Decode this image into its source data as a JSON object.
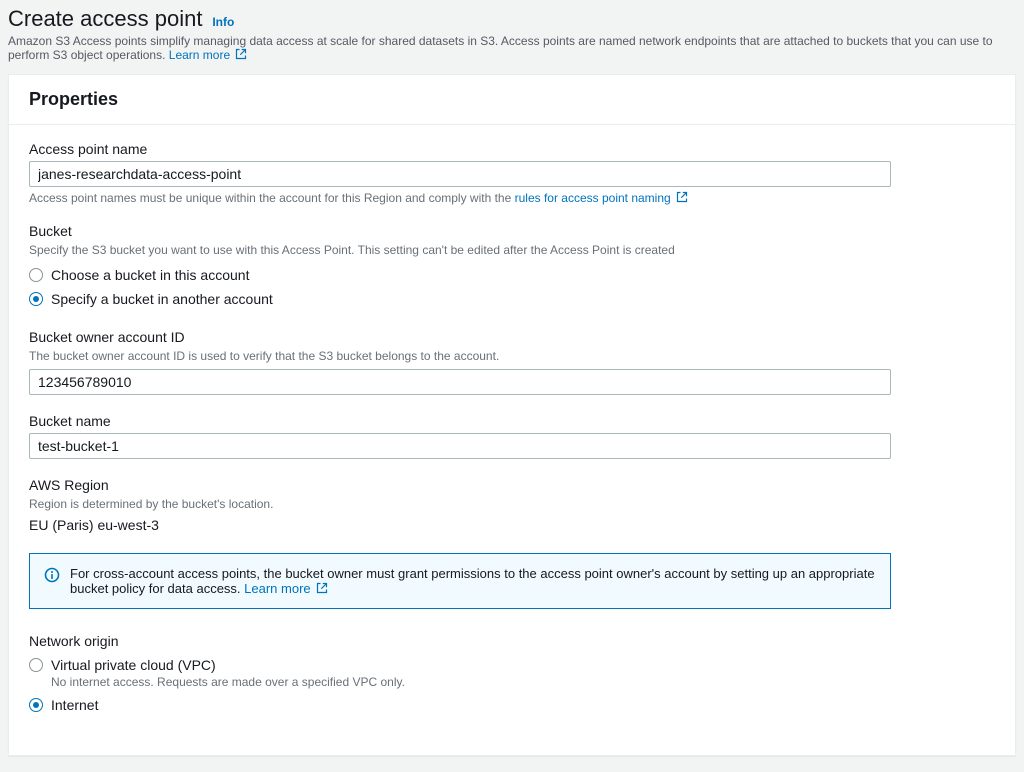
{
  "header": {
    "title": "Create access point",
    "info_label": "Info",
    "description": "Amazon S3 Access points simplify managing data access at scale for shared datasets in S3. Access points are named network endpoints that are attached to buckets that you can use to perform S3 object operations.",
    "learn_more": "Learn more"
  },
  "panel": {
    "title": "Properties"
  },
  "fields": {
    "ap_name": {
      "label": "Access point name",
      "value": "janes-researchdata-access-point",
      "helper_prefix": "Access point names must be unique within the account for this Region and comply with the ",
      "helper_link": "rules for access point naming"
    },
    "bucket": {
      "label": "Bucket",
      "desc": "Specify the S3 bucket you want to use with this Access Point. This setting can't be edited after the Access Point is created",
      "opt_choose": "Choose a bucket in this account",
      "opt_specify": "Specify a bucket in another account"
    },
    "owner_id": {
      "label": "Bucket owner account ID",
      "desc": "The bucket owner account ID is used to verify that the S3 bucket belongs to the account.",
      "value": "123456789010"
    },
    "bucket_name": {
      "label": "Bucket name",
      "value": "test-bucket-1"
    },
    "region": {
      "label": "AWS Region",
      "desc": "Region is determined by the bucket's location.",
      "value": "EU (Paris) eu-west-3"
    },
    "alert": {
      "text": "For cross-account access points, the bucket owner must grant permissions to the access point owner's account by setting up an appropriate bucket policy for data access.",
      "learn_more": "Learn more"
    },
    "network": {
      "label": "Network origin",
      "opt_vpc": "Virtual private cloud (VPC)",
      "vpc_desc": "No internet access. Requests are made over a specified VPC only.",
      "opt_internet": "Internet"
    }
  }
}
